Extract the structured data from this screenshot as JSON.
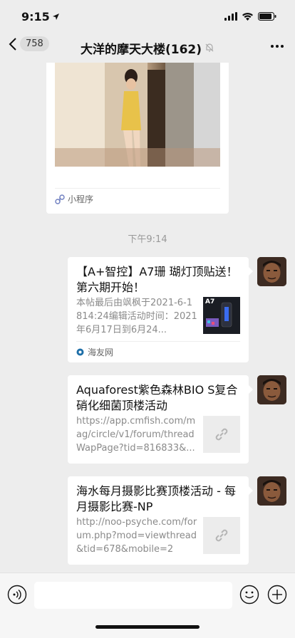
{
  "status": {
    "time": "9:15"
  },
  "nav": {
    "back_count": "758",
    "title": "大洋的摩天大楼(162)"
  },
  "mini_program": {
    "label": "小程序"
  },
  "timestamp": "下午9:14",
  "messages": [
    {
      "title": "【A+智控】A7珊 瑚灯顶贴送！第六期开始！",
      "desc": "本帖最后由飒枫于2021-6-1814:24编辑活动时间：2021年6月17日到6月24...",
      "thumb_label": "A7",
      "source": "海友网"
    },
    {
      "title": "Aquaforest紫色森林BIO S复合硝化细菌顶楼活动",
      "desc": "https://app.cmfish.com/mag/circle/v1/forum/threadWapPage?tid=816833&..."
    },
    {
      "title": "海水每月摄影比赛顶楼活动 - 每月摄影比赛-NP",
      "desc": "http://noo-psyche.com/forum.php?mod=viewthread&tid=678&mobile=2"
    }
  ],
  "colors": {
    "background": "#ededed",
    "bubble": "#ffffff",
    "input_bar": "#f6f6f6"
  }
}
